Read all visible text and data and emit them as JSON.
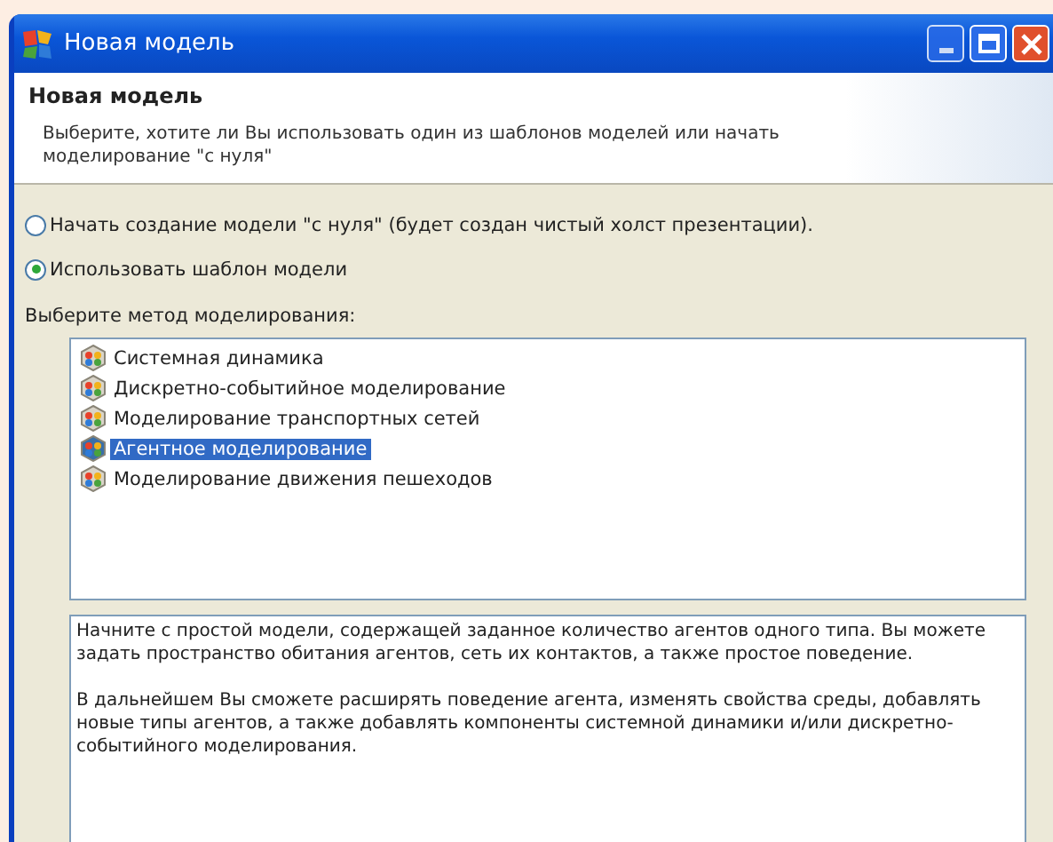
{
  "window": {
    "title": "Новая модель"
  },
  "header": {
    "title": "Новая модель",
    "description": "Выберите, хотите ли Вы использовать один из шаблонов моделей или начать моделирование \"с нуля\""
  },
  "options": [
    {
      "label": "Начать создание модели \"с нуля\" (будет создан чистый холст презентации).",
      "selected": false
    },
    {
      "label": "Использовать шаблон модели",
      "selected": true
    }
  ],
  "methods_label": "Выберите метод моделирования:",
  "methods": [
    {
      "label": "Системная динамика",
      "selected": false
    },
    {
      "label": "Дискретно-событийное моделирование",
      "selected": false
    },
    {
      "label": "Моделирование транспортных сетей",
      "selected": false
    },
    {
      "label": "Агентное моделирование",
      "selected": true
    },
    {
      "label": "Моделирование движения пешеходов",
      "selected": false
    }
  ],
  "details": [
    "Начните с простой модели, содержащей заданное количество агентов одного типа. Вы можете задать пространство обитания агентов, сеть их контактов, а также простое поведение.",
    "В дальнейшем Вы сможете расширять поведение агента, изменять свойства среды, добавлять новые типы агентов, а также добавлять компоненты системной динамики и/или дискретно-событийного моделирования."
  ]
}
